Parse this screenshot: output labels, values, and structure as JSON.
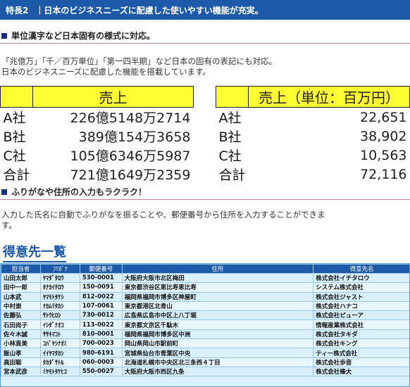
{
  "banner": {
    "tag": "特長2",
    "title": "｜日本のビジネスニーズに配慮した使いやすい機能が充実。"
  },
  "section1": {
    "heading": "単位漢字など日本固有の様式に対応。",
    "desc_line1": "「兆億万」「千／百万単位」「第一四半期」など日本の固有の表記にも対応。",
    "desc_line2": "日本のビジネスニーズに配慮した機能を搭載しています。"
  },
  "kanji_table": {
    "header": "売上",
    "rows": [
      {
        "label": "A社",
        "value": "226億5148万2714"
      },
      {
        "label": "B社",
        "value": "389億154万3658"
      },
      {
        "label": "C社",
        "value": "105億6346万5987"
      },
      {
        "label": "合計",
        "value": "721億1649万2359"
      }
    ]
  },
  "yen_table": {
    "header": "売上（単位：百万円）",
    "rows": [
      {
        "label": "A社",
        "value": "22,651"
      },
      {
        "label": "B社",
        "value": "38,902"
      },
      {
        "label": "C社",
        "value": "10,563"
      },
      {
        "label": "合計",
        "value": "72,116"
      }
    ]
  },
  "section2": {
    "heading": "ふりがなや住所の入力もラクラク！",
    "desc_line1": "入力した氏名に自動でふりがなを振ることや、郵便番号から住所を入力することができま",
    "desc_line2": "す。"
  },
  "customer": {
    "title": "得意先一覧",
    "columns": [
      "担当者",
      "ﾌﾘｶﾞﾅ",
      "郵便番号",
      "住所",
      "得意先名"
    ],
    "rows": [
      [
        "山田太郎",
        "ﾔﾏﾀﾞﾀﾛｳ",
        "530-0001",
        "大阪府大阪市北区梅田",
        "株式会社イチタロウ"
      ],
      [
        "田中一郎",
        "ﾀﾅｶｲﾁﾛｳ",
        "150-0091",
        "東京都渋谷区恵比寿恵比寿",
        "システム株式会社"
      ],
      [
        "山本武",
        "ﾔﾏﾓﾄﾀｹｼ",
        "812-0022",
        "福岡県福岡市博多区神屋町",
        "株式会社ジャスト"
      ],
      [
        "中村崇",
        "ﾅｶﾑﾗﾀｶｼ",
        "107-0061",
        "東京都港区北青山",
        "株式会社ハナコ"
      ],
      [
        "佐藤弘",
        "ｻﾄｳﾋﾛｼ",
        "730-0012",
        "広島県広島市中区上八丁堀",
        "株式会社ピューア"
      ],
      [
        "石田尚子",
        "ｲｼﾀﾞﾅｵｺ",
        "113-0022",
        "東京都文京区千駄木",
        "情報産業株式会社"
      ],
      [
        "佐々木誠",
        "ｻｻｷﾏｺﾄ",
        "810-0001",
        "福岡県福岡市博多区中洲",
        "株式会社タキダ"
      ],
      [
        "小林直美",
        "ｺﾊﾞﾔｼﾅｵﾐ",
        "700-0023",
        "岡山県岡山市駅前町",
        "株式会社キング"
      ],
      [
        "飯山孝",
        "ｲｲﾔﾏﾀｶｼ",
        "980-6191",
        "宮城県仙台市青葉区中央",
        "ティー株式会社"
      ],
      [
        "高田聡",
        "ﾀｶﾀﾞｻﾄﾙ",
        "060-0003",
        "北海道札幌市中央区北三条西４丁目",
        "株式会社歩音"
      ],
      [
        "宮本武彦",
        "ﾐﾔﾓﾄﾀｹﾋｺ",
        "550-0027",
        "大阪府大阪市西区九条",
        "株式会社榛大"
      ]
    ]
  }
}
